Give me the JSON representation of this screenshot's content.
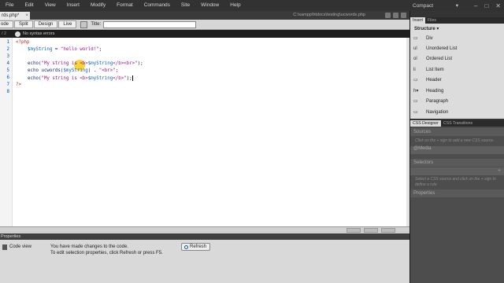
{
  "menubar": {
    "items": [
      "File",
      "Edit",
      "View",
      "Insert",
      "Modify",
      "Format",
      "Commands",
      "Site",
      "Window",
      "Help"
    ],
    "workspace": "Compact"
  },
  "document": {
    "tab_label": "rds.php*",
    "path": "C:\\xampp\\htdocs\\testing\\ucwords.php"
  },
  "view_toolbar": {
    "buttons": [
      "ode",
      "Split",
      "Design",
      "Live"
    ],
    "title_label": "Title:",
    "title_value": ""
  },
  "infobar": {
    "line_col": "/ 2",
    "message": "No syntax errors"
  },
  "code": {
    "line_numbers": [
      "1",
      "2",
      "3",
      "4",
      "5",
      "6",
      "7",
      "8"
    ],
    "open_tag": "<?php",
    "line2_var": "$myString",
    "line2_op": " = ",
    "line2_str": "\"hello world!\"",
    "line2_end": ";",
    "line4_fn": "echo(",
    "line4_str1": "\"My string is <b>",
    "line4_var": "$myString",
    "line4_str2": "</b><br>\"",
    "line4_end": ");",
    "line5_fn": "echo ",
    "line5_ucw": "ucwords(",
    "line5_var": "$myString",
    "line5_mid": ") . ",
    "line5_str": "\"<br>\"",
    "line5_end": ";",
    "line6_fn": "echo(",
    "line6_str1": "\"My string is <b>",
    "line6_var": "$myString",
    "line6_str2": "</b>\"",
    "line6_end": ");",
    "close_tag": "?>"
  },
  "properties": {
    "header": "Properties",
    "code_view": "Code view",
    "message_line1": "You have made changes to the code.",
    "message_line2": "To edit selection properties, click Refresh or press F5.",
    "refresh_label": "Refresh"
  },
  "right_panel": {
    "tabs": [
      "Insert",
      "Files"
    ],
    "structure_label": "Structure",
    "insert_items": [
      {
        "icon": "div-icon",
        "label": "Div"
      },
      {
        "icon": "ul-icon",
        "label": "Unordered List"
      },
      {
        "icon": "ol-icon",
        "label": "Ordered List"
      },
      {
        "icon": "li-icon",
        "label": "List Item"
      },
      {
        "icon": "header-icon",
        "label": "Header"
      },
      {
        "icon": "heading-icon",
        "label": "Heading"
      },
      {
        "icon": "paragraph-icon",
        "label": "Paragraph"
      },
      {
        "icon": "nav-icon",
        "label": "Navigation"
      }
    ],
    "css_tabs": [
      "CSS Designer",
      "CSS Transitions"
    ],
    "sources_label": "Sources",
    "sources_hint": "Click on the + sign to add a new CSS source.",
    "media_label": "@Media",
    "selectors_label": "Selectors",
    "selectors_hint": "Select a CSS source and click on the + sign to define a rule.",
    "properties_label": "Properties"
  },
  "colors": {
    "php_tag": "#c8201e",
    "variable": "#0a62c0",
    "string": "#a0148c",
    "cursor_highlight": "#f8cd14"
  }
}
